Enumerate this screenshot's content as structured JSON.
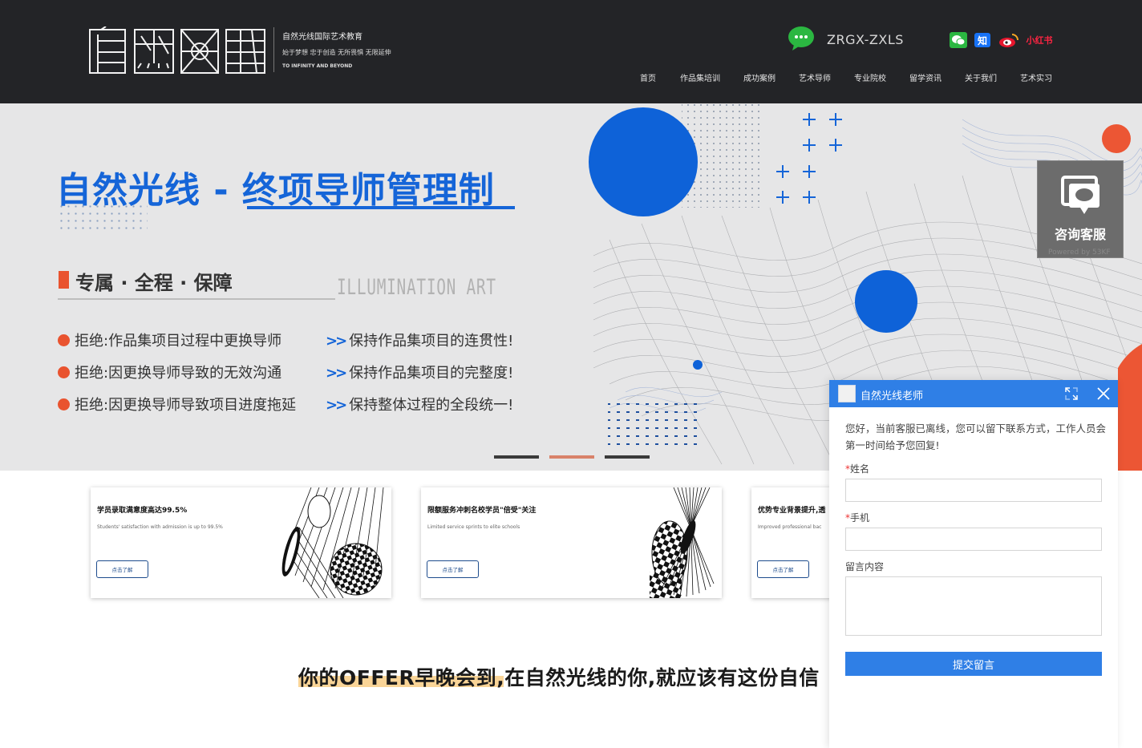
{
  "header": {
    "logo_text": "自然光线",
    "tagline1": "自然光线国际艺术教育",
    "tagline2": "始于梦想 忠于创造 无所畏惧 无限延伸",
    "tagline3": "TO INFINITY AND BEYOND",
    "wechat_id": "ZRGX-ZXLS",
    "social": {
      "zhihu": "知",
      "xiaohongshu": "小红书"
    },
    "nav": [
      "首页",
      "作品集培训",
      "成功案例",
      "艺术导师",
      "专业院校",
      "留学资讯",
      "关于我们",
      "艺术实习"
    ]
  },
  "banner": {
    "title_part1": "自然光线 - ",
    "title_part2": "终项导师管理制",
    "subtitle": "专属 · 全程 · 保障",
    "watermark": "ILLUMINATION ART",
    "left_points": [
      "拒绝:作品集项目过程中更换导师",
      "拒绝:因更换导师导致的无效沟通",
      "拒绝:因更换导师导致项目进度拖延"
    ],
    "right_points": [
      "保持作品集项目的连贯性!",
      "保持作品集项目的完整度!",
      "保持整体过程的全段统一!"
    ],
    "active_slide": 2,
    "colors": {
      "accent_blue": "#1565d8",
      "accent_red": "#e9532f"
    }
  },
  "consult": {
    "label": "咨询客服",
    "powered": "Powered by 53KF"
  },
  "cards": [
    {
      "title": "学员录取满意度高达99.5%",
      "subtitle": "Students' satisfaction with admission is up to 99.5%",
      "button": "点击了解"
    },
    {
      "title": "限额服务冲刺名校学员\"倍受\"关注",
      "subtitle": "Limited service sprints to elite schools",
      "button": "点击了解"
    },
    {
      "title": "优势专业背景提升,透",
      "subtitle": "Improved professional bac",
      "button": "点击了解"
    }
  ],
  "offer_text": "你的OFFER早晚会到,在自然光线的你,就应该有这份自信",
  "chat": {
    "agent_name": "自然光线老师",
    "message": "您好，当前客服已离线，您可以留下联系方式，工作人员会第一时间给予您回复!",
    "name_label": "姓名",
    "phone_label": "手机",
    "message_label": "留言内容",
    "name_value": "",
    "phone_value": "",
    "message_value": "",
    "submit_label": "提交留言"
  }
}
